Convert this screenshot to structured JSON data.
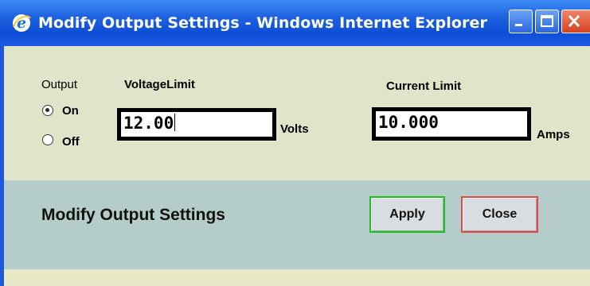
{
  "window": {
    "title": "Modify Output Settings - Windows Internet Explorer",
    "icon": "internet-explorer-icon",
    "controls": [
      "minimize-icon",
      "maximize-icon",
      "close-icon"
    ]
  },
  "output": {
    "label": "Output",
    "options": [
      {
        "label": "On",
        "selected": true
      },
      {
        "label": "Off",
        "selected": false
      }
    ]
  },
  "voltage": {
    "label": "VoltageLimit",
    "value": "12.00",
    "unit": "Volts"
  },
  "current": {
    "label": "Current Limit",
    "value": "10.000",
    "unit": "Amps"
  },
  "actions": {
    "title": "Modify Output Settings",
    "apply_label": "Apply",
    "close_label": "Close"
  },
  "colors": {
    "titlebar": "#0f4fd6",
    "settings_bg": "#dfe5c9",
    "band_bg": "#b5cdca",
    "apply_border": "#18c418",
    "close_border": "#e64545"
  }
}
